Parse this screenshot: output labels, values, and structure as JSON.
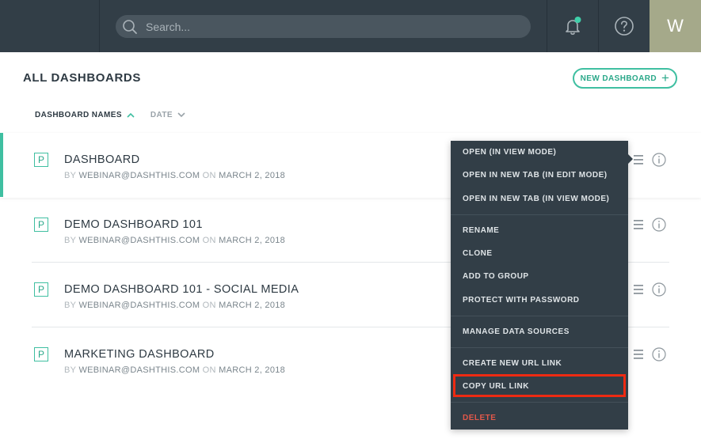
{
  "header": {
    "search_placeholder": "Search...",
    "avatar_initial": "W",
    "notification_dot_color": "#3fcfa9"
  },
  "page": {
    "title": "ALL DASHBOARDS",
    "new_dashboard_label": "NEW DASHBOARD",
    "new_dashboard_icon": "+"
  },
  "sort": {
    "names_label": "DASHBOARD NAMES",
    "date_label": "DATE"
  },
  "dashboards": [
    {
      "icon": "P",
      "name": "DASHBOARD",
      "by": "BY",
      "author": "WEBINAR@DASHTHIS.COM",
      "on": "ON",
      "date": "MARCH 2, 2018"
    },
    {
      "icon": "P",
      "name": "DEMO DASHBOARD 101",
      "by": "BY",
      "author": "WEBINAR@DASHTHIS.COM",
      "on": "ON",
      "date": "MARCH 2, 2018"
    },
    {
      "icon": "P",
      "name": "DEMO DASHBOARD 101 - SOCIAL MEDIA",
      "by": "BY",
      "author": "WEBINAR@DASHTHIS.COM",
      "on": "ON",
      "date": "MARCH 2, 2018"
    },
    {
      "icon": "P",
      "name": "MARKETING DASHBOARD",
      "by": "BY",
      "author": "WEBINAR@DASHTHIS.COM",
      "on": "ON",
      "date": "MARCH 2, 2018"
    }
  ],
  "context_menu": {
    "items": [
      "OPEN (IN VIEW MODE)",
      "OPEN IN NEW TAB (IN EDIT MODE)",
      "OPEN IN NEW TAB (IN VIEW MODE)",
      "RENAME",
      "CLONE",
      "ADD TO GROUP",
      "PROTECT WITH PASSWORD",
      "MANAGE DATA SOURCES",
      "CREATE NEW URL LINK",
      "COPY URL LINK",
      "DELETE"
    ]
  },
  "colors": {
    "accent": "#3fbfa1",
    "topbar": "#323e47",
    "danger": "#e1584a",
    "highlight": "#ee2a12"
  }
}
